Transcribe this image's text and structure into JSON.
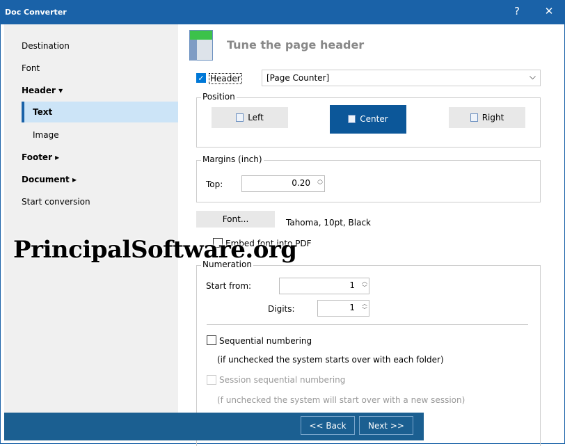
{
  "window": {
    "title": "Doc Converter",
    "help": "?",
    "close": "✕"
  },
  "sidebar": {
    "items": [
      {
        "label": "Destination"
      },
      {
        "label": "Font"
      },
      {
        "label": "Header ▾"
      },
      {
        "label": "Text"
      },
      {
        "label": "Image"
      },
      {
        "label": "Footer ▸"
      },
      {
        "label": "Document ▸"
      },
      {
        "label": "Start conversion"
      }
    ]
  },
  "main": {
    "heading": "Tune the page header",
    "header_checkbox": {
      "label": "Header",
      "checked": true
    },
    "header_select": {
      "value": "[Page Counter]"
    },
    "position": {
      "label": "Position",
      "buttons": [
        "Left",
        "Center",
        "Right"
      ],
      "selected": "Center"
    },
    "margins": {
      "label": "Margins (inch)",
      "top_label": "Top:",
      "top_value": "0.20"
    },
    "font": {
      "button": "Font...",
      "description": "Tahoma, 10pt, Black"
    },
    "embed": {
      "label": "Embed font into PDF",
      "checked": false
    },
    "numeration": {
      "label": "Numeration",
      "start_label": "Start from:",
      "start_value": "1",
      "digits_label": "Digits:",
      "digits_value": "1",
      "sequential": {
        "label": "Sequential numbering",
        "note": "(if unchecked the system starts over with each folder)",
        "checked": false
      },
      "session": {
        "label": "Session sequential numbering",
        "note": "(f unchecked the system will start over with a new session)",
        "checked": false,
        "disabled": true
      }
    }
  },
  "footer": {
    "back": "<< Back",
    "next": "Next >>"
  },
  "watermark": "PrincipalSoftware.org",
  "colors": {
    "accent": "#1a62a8",
    "selected_button": "#0c5799",
    "bottom_bar": "#1b5f91"
  }
}
